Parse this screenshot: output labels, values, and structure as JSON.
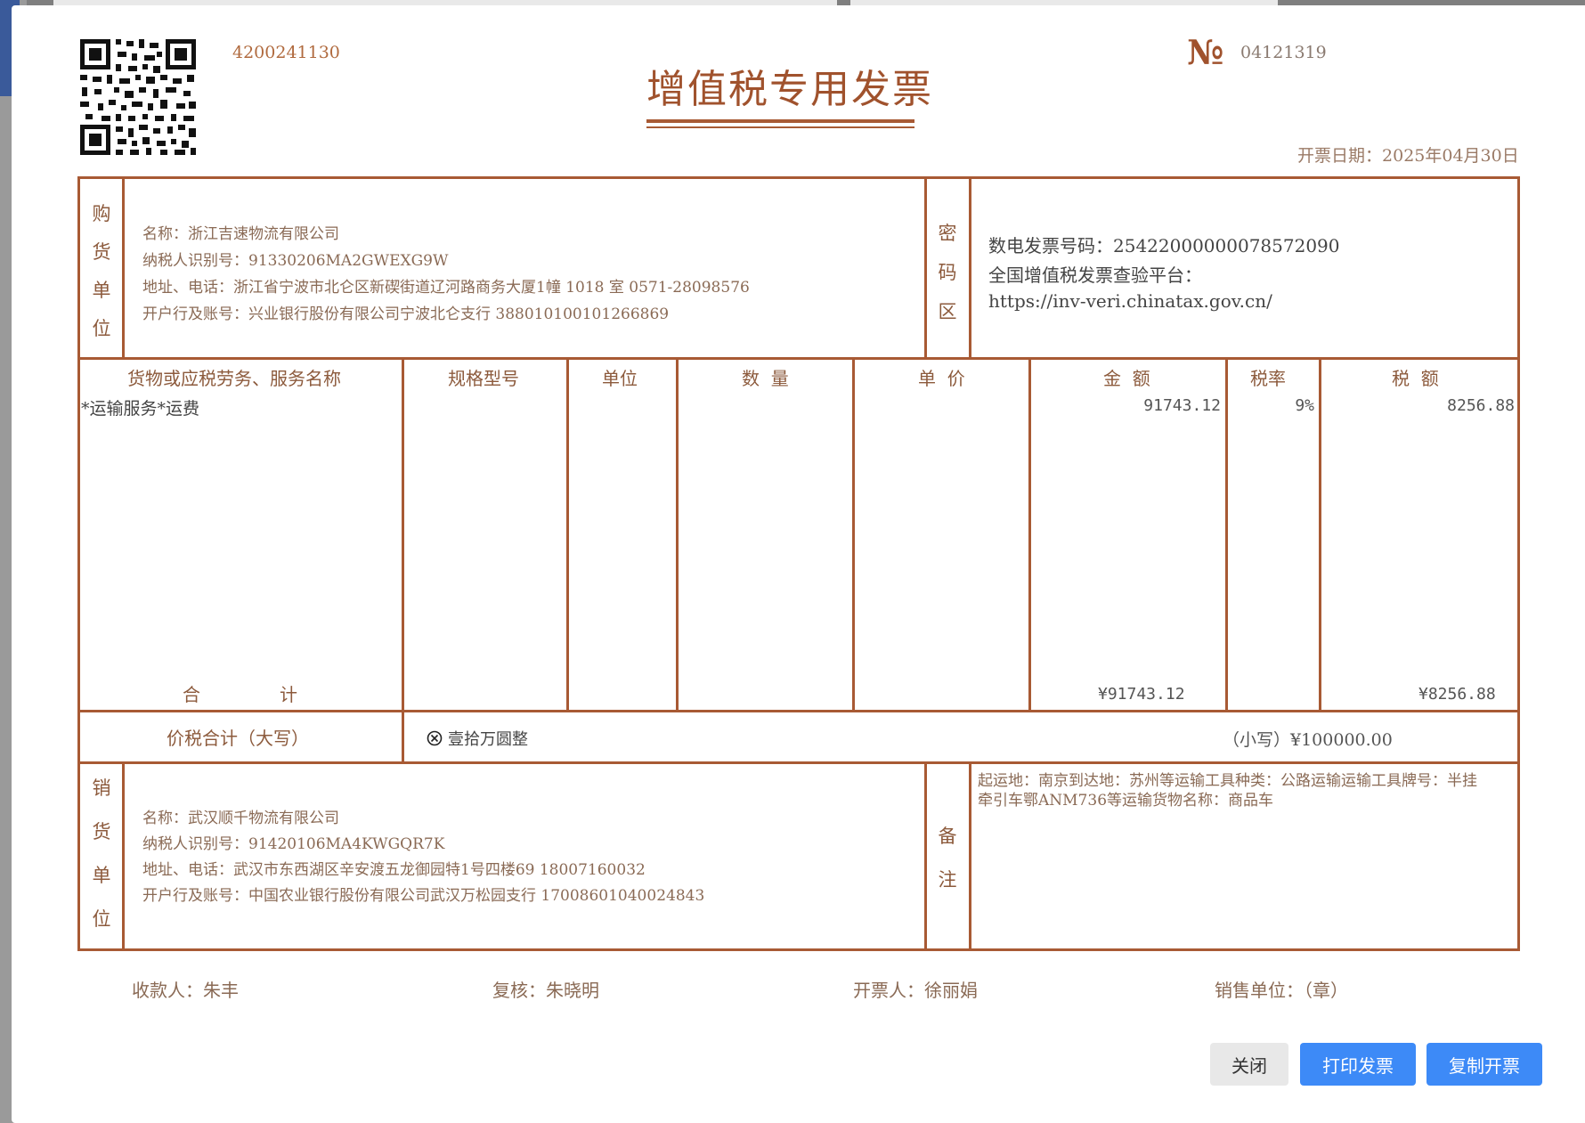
{
  "invoice": {
    "code": "4200241130",
    "no_symbol": "№",
    "number": "04121319",
    "title": "增值税专用发票",
    "date_label": "开票日期：",
    "date_value": "2025年04月30日",
    "buyer": {
      "side_label": [
        "购",
        "货",
        "单",
        "位"
      ],
      "name": "名称：浙江吉速物流有限公司",
      "tax_id": "纳税人识别号：91330206MA2GWEXG9W",
      "address": "地址、电话：浙江省宁波市北仑区新碶街道辽河路商务大厦1幢 1018 室 0571-28098576",
      "bank": "开户行及账号：兴业银行股份有限公司宁波北仑支行 388010100101266869"
    },
    "cipher": {
      "side_label": [
        "密",
        "码",
        "区"
      ],
      "line1": "数电发票号码：25422000000078572090",
      "line2": "全国增值税发票查验平台：",
      "line3": "https://inv-veri.chinatax.gov.cn/"
    },
    "columns": [
      "货物或应税劳务、服务名称",
      "规格型号",
      "单位",
      "数  量",
      "单  价",
      "金  额",
      "税率",
      "税  额"
    ],
    "items": [
      {
        "name": "*运输服务*运费",
        "spec": "",
        "unit": "",
        "qty": "",
        "price": "",
        "amount": "91743.12",
        "rate": "9%",
        "tax": "8256.88"
      }
    ],
    "total_label": "合              计",
    "total_amount": "¥91743.12",
    "total_tax": "¥8256.88",
    "grand_label": "价税合计（大写）",
    "grand_upper": "壹拾万圆整",
    "grand_lower": "（小写）¥100000.00",
    "seller": {
      "side_label": [
        "销",
        "货",
        "单",
        "位"
      ],
      "name": "名称：武汉顺千物流有限公司",
      "tax_id": "纳税人识别号：91420106MA4KWGQR7K",
      "address": "地址、电话：武汉市东西湖区辛安渡五龙御园特1号四楼69 18007160032",
      "bank": "开户行及账号：中国农业银行股份有限公司武汉万松园支行 17008601040024843"
    },
    "remark": {
      "side_label": [
        "备",
        "注"
      ],
      "text1": "起运地：南京到达地：苏州等运输工具种类：公路运输运输工具牌号：半挂",
      "text2": "牵引车鄂ANM736等运输货物名称：商品车"
    },
    "footer": {
      "payee": "收款人：朱丰",
      "reviewer": "复核：朱晓明",
      "issuer": "开票人：徐丽娟",
      "seller_seal": "销售单位：（章）"
    }
  },
  "buttons": {
    "close": "关闭",
    "print": "打印发票",
    "copy": "复制开票"
  },
  "colors": {
    "invoice_brown": "#a85a34",
    "button_blue": "#3d8af7",
    "button_grey": "#e8e8e8"
  }
}
